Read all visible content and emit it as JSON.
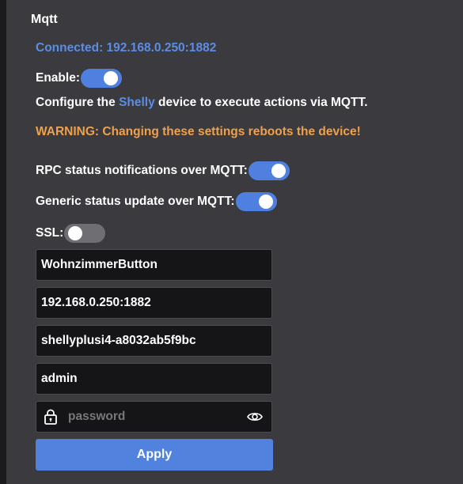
{
  "section": {
    "title": "Mqtt",
    "status": "Connected: 192.168.0.250:1882"
  },
  "enable": {
    "label": "Enable:",
    "checked": true
  },
  "description": {
    "prefix": "Configure the ",
    "brand": "Shelly",
    "suffix": " device to execute actions via MQTT."
  },
  "warning": "WARNING: Changing these settings reboots the device!",
  "rpc_status": {
    "label": "RPC status notifications over MQTT:",
    "checked": true
  },
  "generic_status": {
    "label": "Generic status update over MQTT:",
    "checked": true
  },
  "ssl": {
    "label": "SSL:",
    "checked": false
  },
  "fields": {
    "client_id": "WohnzimmerButton",
    "server": "192.168.0.250:1882",
    "topic_prefix": "shellyplusi4-a8032ab5f9bc",
    "user": "admin",
    "password_placeholder": "password"
  },
  "apply_label": "Apply",
  "colors": {
    "accent": "#5183de",
    "link": "#5b8de5",
    "warning": "#f0a04b",
    "panel": "#3b3b3f",
    "input_bg": "#151517"
  },
  "icons": {
    "lock": "lock-icon",
    "eye": "eye-icon"
  }
}
